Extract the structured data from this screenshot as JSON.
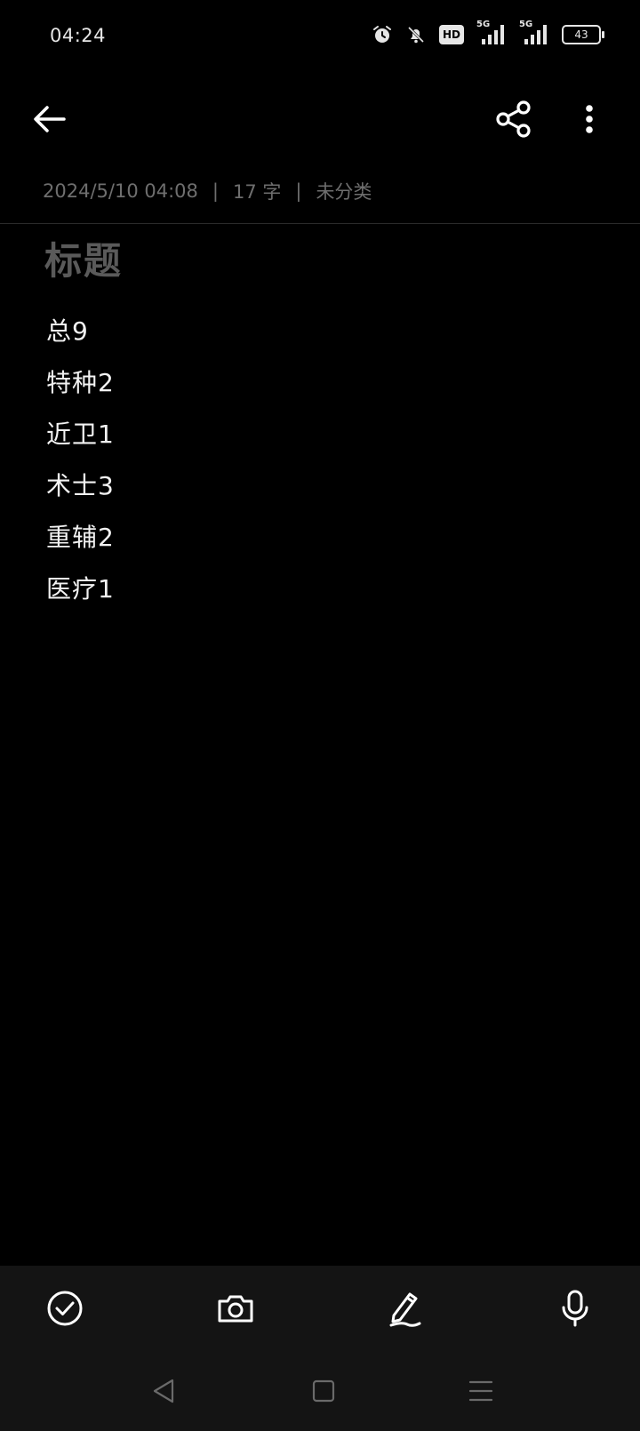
{
  "status_bar": {
    "time": "04:24",
    "network_1": "5G",
    "network_2": "5G",
    "hd_label": "HD",
    "battery_level": "43",
    "icons": [
      "alarm-icon",
      "mute-notifications-icon",
      "hd-voice-icon",
      "signal-icon",
      "signal-icon",
      "battery-icon"
    ]
  },
  "toolbar": {
    "back_icon": "arrow-left-icon",
    "share_icon": "share-icon",
    "more_icon": "more-vertical-icon"
  },
  "meta": {
    "datetime": "2024/5/10 04:08",
    "separator": "|",
    "word_count": "17 字",
    "category": "未分类"
  },
  "note": {
    "title_placeholder": "标题",
    "lines": [
      "总9",
      "特种2",
      "近卫1",
      "术士3",
      "重辅2",
      "医疗1"
    ]
  },
  "bottom_toolbar": {
    "items": [
      "checklist-icon",
      "camera-icon",
      "handwriting-icon",
      "microphone-icon"
    ]
  },
  "nav_bar": {
    "items": [
      "nav-back-icon",
      "nav-home-icon",
      "nav-recent-icon"
    ]
  },
  "colors": {
    "background": "#000000",
    "bottom_bar": "#141414",
    "meta_text": "#6e6e6e",
    "title_placeholder": "#5a5a5a",
    "body_text": "#f2f2f2"
  }
}
